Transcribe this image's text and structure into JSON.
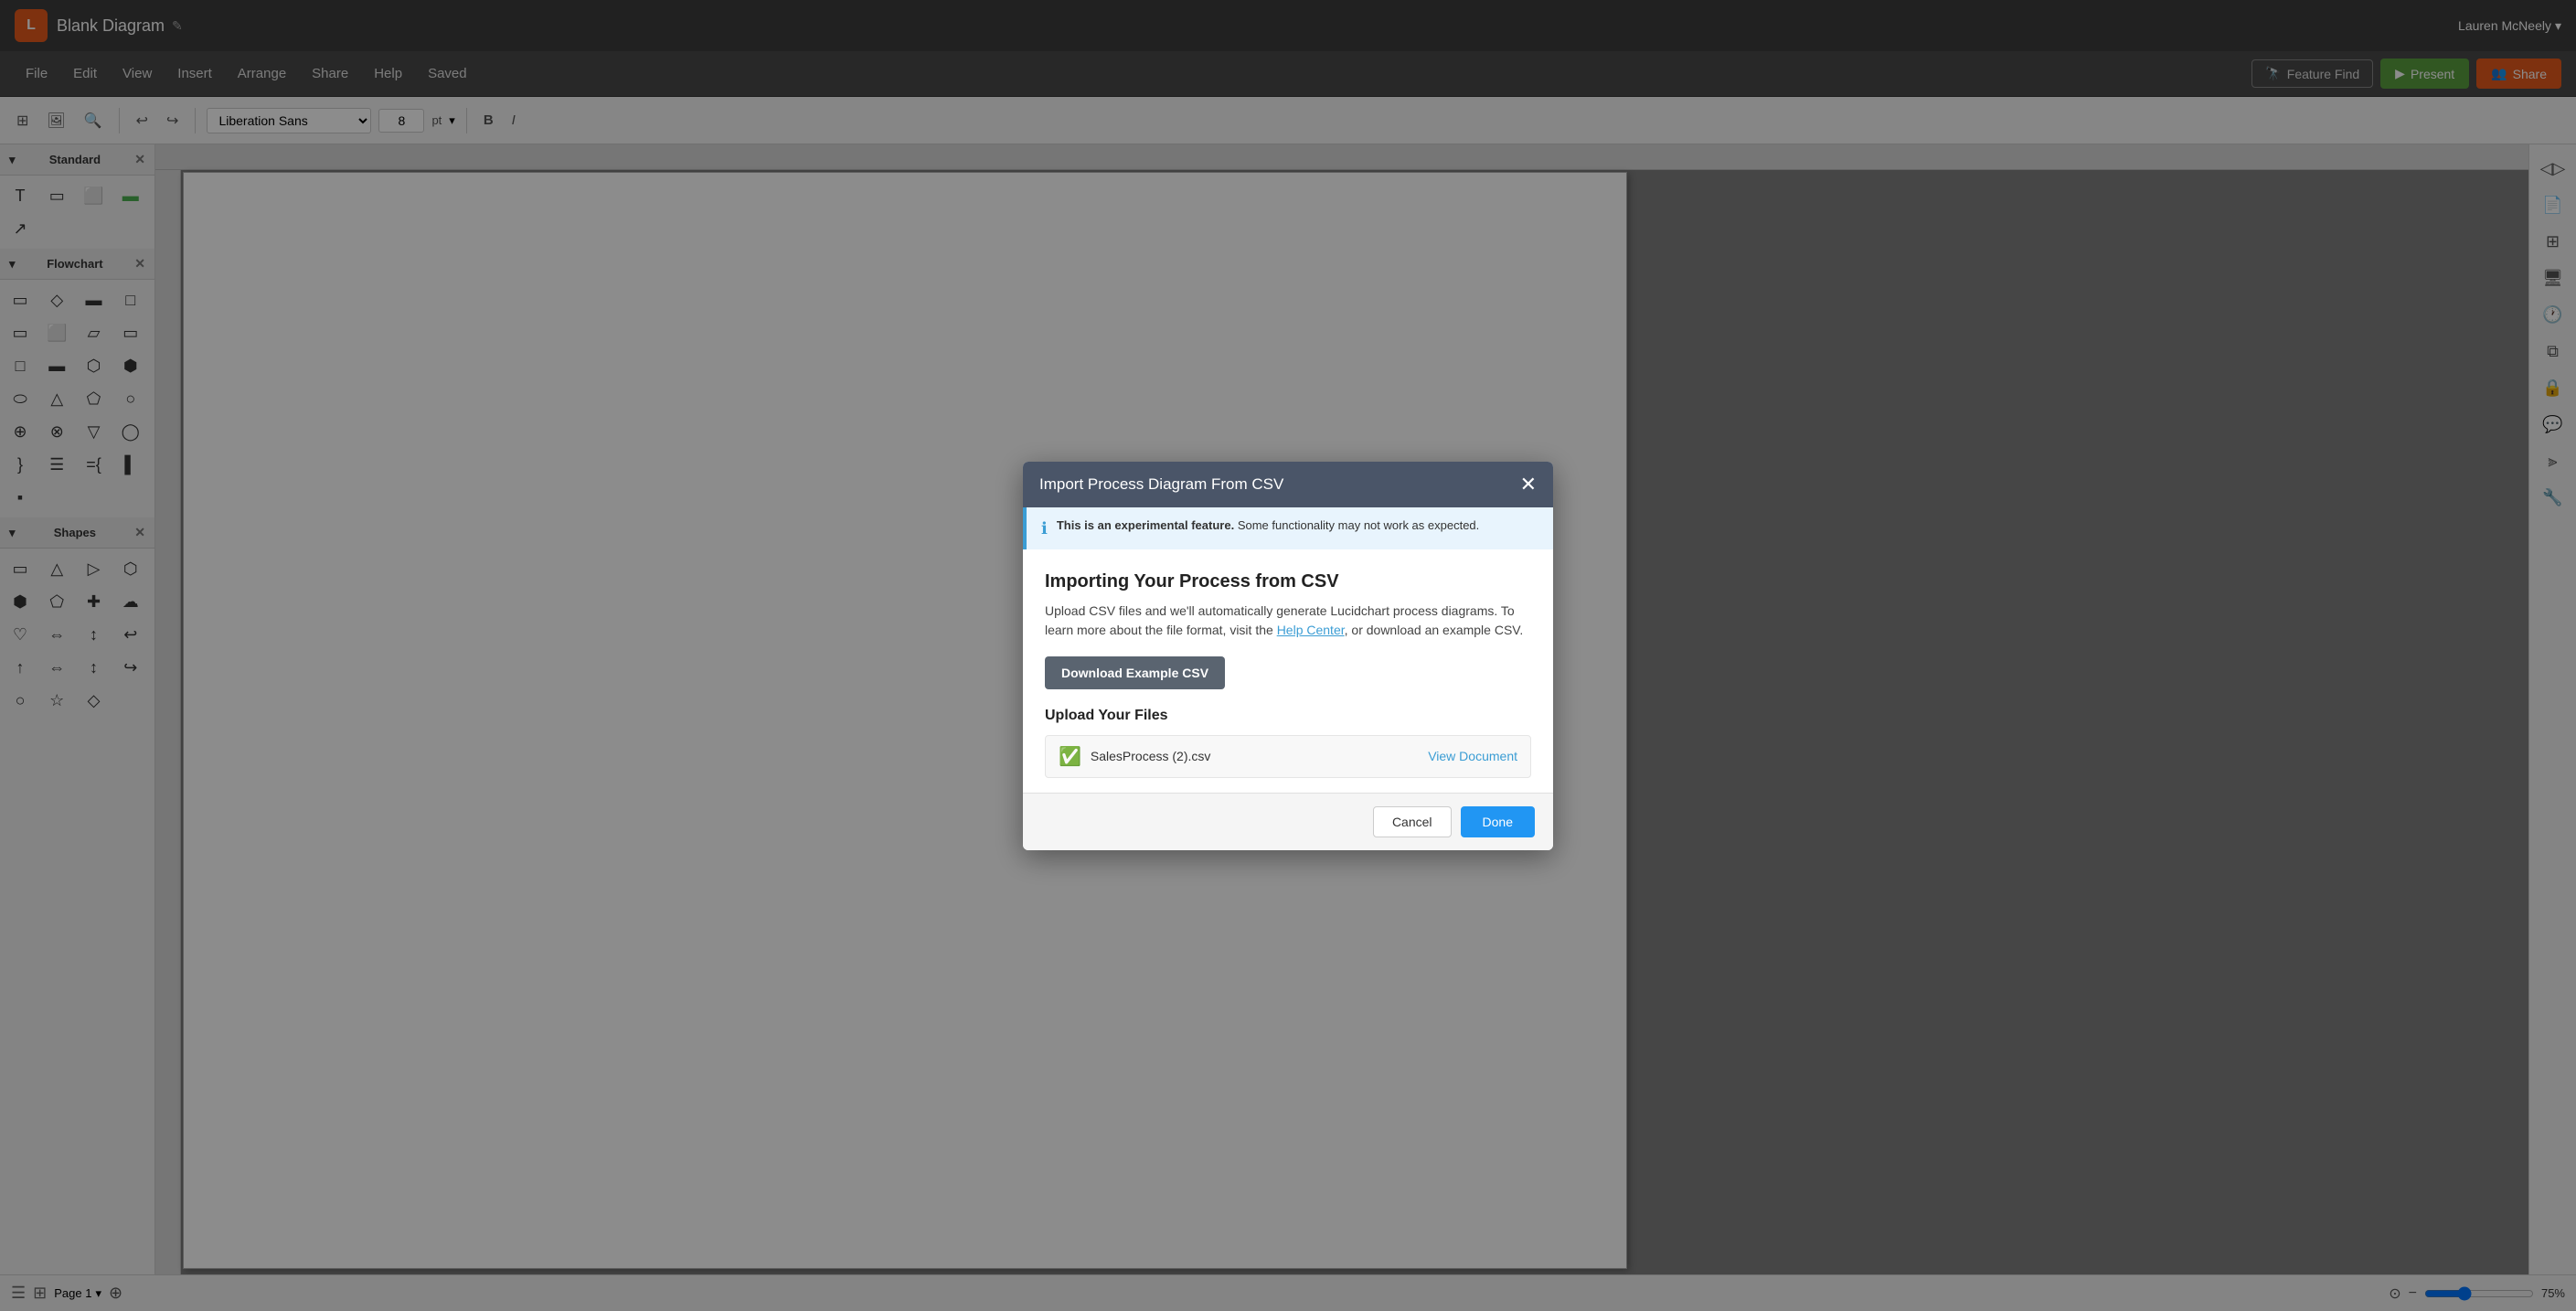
{
  "titlebar": {
    "app_logo": "L",
    "doc_title": "Blank Diagram",
    "user_name": "Lauren McNeely",
    "chevron": "▾"
  },
  "menubar": {
    "items": [
      "File",
      "Edit",
      "View",
      "Insert",
      "Arrange",
      "Share",
      "Help",
      "Saved"
    ],
    "feature_find_label": "Feature Find",
    "present_label": "Present",
    "share_label": "Share"
  },
  "formatbar": {
    "font_family": "Liberation Sans",
    "font_size": "8",
    "font_unit": "pt",
    "bold": "B",
    "italic": "I"
  },
  "left_panel": {
    "standard_label": "Standard",
    "flowchart_label": "Flowchart",
    "shapes_label": "Shapes"
  },
  "bottombar": {
    "page_label": "Page 1",
    "zoom_level": "75%"
  },
  "dialog": {
    "title": "Import Process Diagram From CSV",
    "info_text_bold": "This is an experimental feature.",
    "info_text": " Some functionality may not work as expected.",
    "import_title": "Importing Your Process from CSV",
    "desc_part1": "Upload CSV files and we'll automatically generate Lucidchart process diagrams. To learn more about the file format, visit the ",
    "help_center_link": "Help Center",
    "desc_part2": ", or download an example CSV.",
    "download_btn_label": "Download Example CSV",
    "upload_title": "Upload Your Files",
    "file_name": "SalesProcess (2).csv",
    "view_doc_label": "View Document",
    "cancel_label": "Cancel",
    "done_label": "Done"
  }
}
